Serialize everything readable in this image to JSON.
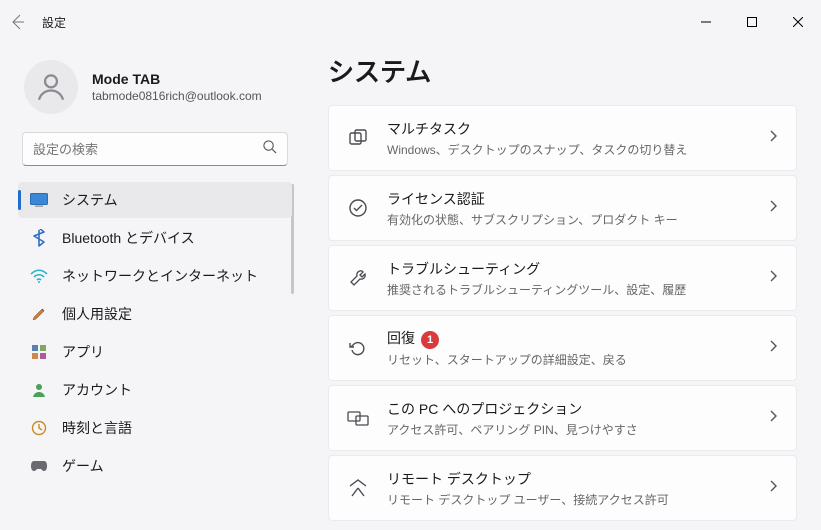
{
  "titlebar": {
    "title": "設定"
  },
  "profile": {
    "name": "Mode TAB",
    "email": "tabmode0816rich@outlook.com"
  },
  "search": {
    "placeholder": "設定の検索"
  },
  "sidebar": {
    "items": [
      {
        "label": "システム"
      },
      {
        "label": "Bluetooth とデバイス"
      },
      {
        "label": "ネットワークとインターネット"
      },
      {
        "label": "個人用設定"
      },
      {
        "label": "アプリ"
      },
      {
        "label": "アカウント"
      },
      {
        "label": "時刻と言語"
      },
      {
        "label": "ゲーム"
      }
    ]
  },
  "page": {
    "title": "システム"
  },
  "cards": [
    {
      "title": "マルチタスク",
      "sub": "Windows、デスクトップのスナップ、タスクの切り替え"
    },
    {
      "title": "ライセンス認証",
      "sub": "有効化の状態、サブスクリプション、プロダクト キー"
    },
    {
      "title": "トラブルシューティング",
      "sub": "推奨されるトラブルシューティングツール、設定、履歴"
    },
    {
      "title": "回復",
      "sub": "リセット、スタートアップの詳細設定、戻る",
      "badge": "1"
    },
    {
      "title": "この PC へのプロジェクション",
      "sub": "アクセス許可、ペアリング PIN、見つけやすさ"
    },
    {
      "title": "リモート デスクトップ",
      "sub": "リモート デスクトップ ユーザー、接続アクセス許可"
    }
  ]
}
